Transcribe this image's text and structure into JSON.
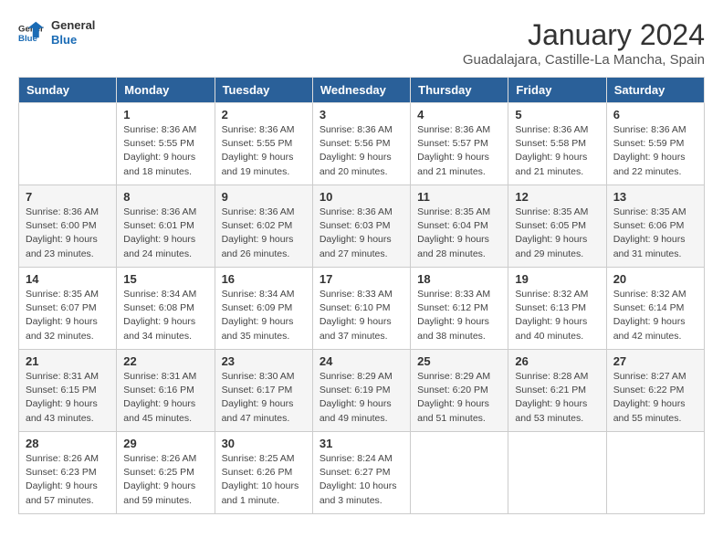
{
  "logo": {
    "general": "General",
    "blue": "Blue"
  },
  "title": "January 2024",
  "location": "Guadalajara, Castille-La Mancha, Spain",
  "days_of_week": [
    "Sunday",
    "Monday",
    "Tuesday",
    "Wednesday",
    "Thursday",
    "Friday",
    "Saturday"
  ],
  "weeks": [
    [
      {
        "day": "",
        "info": ""
      },
      {
        "day": "1",
        "info": "Sunrise: 8:36 AM\nSunset: 5:55 PM\nDaylight: 9 hours\nand 18 minutes."
      },
      {
        "day": "2",
        "info": "Sunrise: 8:36 AM\nSunset: 5:55 PM\nDaylight: 9 hours\nand 19 minutes."
      },
      {
        "day": "3",
        "info": "Sunrise: 8:36 AM\nSunset: 5:56 PM\nDaylight: 9 hours\nand 20 minutes."
      },
      {
        "day": "4",
        "info": "Sunrise: 8:36 AM\nSunset: 5:57 PM\nDaylight: 9 hours\nand 21 minutes."
      },
      {
        "day": "5",
        "info": "Sunrise: 8:36 AM\nSunset: 5:58 PM\nDaylight: 9 hours\nand 21 minutes."
      },
      {
        "day": "6",
        "info": "Sunrise: 8:36 AM\nSunset: 5:59 PM\nDaylight: 9 hours\nand 22 minutes."
      }
    ],
    [
      {
        "day": "7",
        "info": "Sunrise: 8:36 AM\nSunset: 6:00 PM\nDaylight: 9 hours\nand 23 minutes."
      },
      {
        "day": "8",
        "info": "Sunrise: 8:36 AM\nSunset: 6:01 PM\nDaylight: 9 hours\nand 24 minutes."
      },
      {
        "day": "9",
        "info": "Sunrise: 8:36 AM\nSunset: 6:02 PM\nDaylight: 9 hours\nand 26 minutes."
      },
      {
        "day": "10",
        "info": "Sunrise: 8:36 AM\nSunset: 6:03 PM\nDaylight: 9 hours\nand 27 minutes."
      },
      {
        "day": "11",
        "info": "Sunrise: 8:35 AM\nSunset: 6:04 PM\nDaylight: 9 hours\nand 28 minutes."
      },
      {
        "day": "12",
        "info": "Sunrise: 8:35 AM\nSunset: 6:05 PM\nDaylight: 9 hours\nand 29 minutes."
      },
      {
        "day": "13",
        "info": "Sunrise: 8:35 AM\nSunset: 6:06 PM\nDaylight: 9 hours\nand 31 minutes."
      }
    ],
    [
      {
        "day": "14",
        "info": "Sunrise: 8:35 AM\nSunset: 6:07 PM\nDaylight: 9 hours\nand 32 minutes."
      },
      {
        "day": "15",
        "info": "Sunrise: 8:34 AM\nSunset: 6:08 PM\nDaylight: 9 hours\nand 34 minutes."
      },
      {
        "day": "16",
        "info": "Sunrise: 8:34 AM\nSunset: 6:09 PM\nDaylight: 9 hours\nand 35 minutes."
      },
      {
        "day": "17",
        "info": "Sunrise: 8:33 AM\nSunset: 6:10 PM\nDaylight: 9 hours\nand 37 minutes."
      },
      {
        "day": "18",
        "info": "Sunrise: 8:33 AM\nSunset: 6:12 PM\nDaylight: 9 hours\nand 38 minutes."
      },
      {
        "day": "19",
        "info": "Sunrise: 8:32 AM\nSunset: 6:13 PM\nDaylight: 9 hours\nand 40 minutes."
      },
      {
        "day": "20",
        "info": "Sunrise: 8:32 AM\nSunset: 6:14 PM\nDaylight: 9 hours\nand 42 minutes."
      }
    ],
    [
      {
        "day": "21",
        "info": "Sunrise: 8:31 AM\nSunset: 6:15 PM\nDaylight: 9 hours\nand 43 minutes."
      },
      {
        "day": "22",
        "info": "Sunrise: 8:31 AM\nSunset: 6:16 PM\nDaylight: 9 hours\nand 45 minutes."
      },
      {
        "day": "23",
        "info": "Sunrise: 8:30 AM\nSunset: 6:17 PM\nDaylight: 9 hours\nand 47 minutes."
      },
      {
        "day": "24",
        "info": "Sunrise: 8:29 AM\nSunset: 6:19 PM\nDaylight: 9 hours\nand 49 minutes."
      },
      {
        "day": "25",
        "info": "Sunrise: 8:29 AM\nSunset: 6:20 PM\nDaylight: 9 hours\nand 51 minutes."
      },
      {
        "day": "26",
        "info": "Sunrise: 8:28 AM\nSunset: 6:21 PM\nDaylight: 9 hours\nand 53 minutes."
      },
      {
        "day": "27",
        "info": "Sunrise: 8:27 AM\nSunset: 6:22 PM\nDaylight: 9 hours\nand 55 minutes."
      }
    ],
    [
      {
        "day": "28",
        "info": "Sunrise: 8:26 AM\nSunset: 6:23 PM\nDaylight: 9 hours\nand 57 minutes."
      },
      {
        "day": "29",
        "info": "Sunrise: 8:26 AM\nSunset: 6:25 PM\nDaylight: 9 hours\nand 59 minutes."
      },
      {
        "day": "30",
        "info": "Sunrise: 8:25 AM\nSunset: 6:26 PM\nDaylight: 10 hours\nand 1 minute."
      },
      {
        "day": "31",
        "info": "Sunrise: 8:24 AM\nSunset: 6:27 PM\nDaylight: 10 hours\nand 3 minutes."
      },
      {
        "day": "",
        "info": ""
      },
      {
        "day": "",
        "info": ""
      },
      {
        "day": "",
        "info": ""
      }
    ]
  ]
}
